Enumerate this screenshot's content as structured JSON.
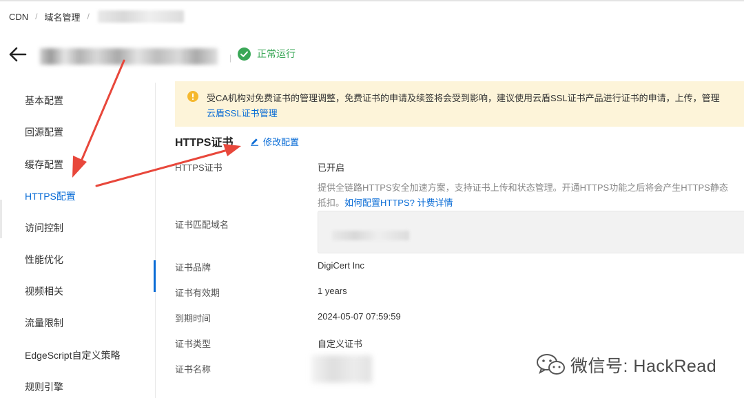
{
  "breadcrumb": {
    "items": [
      "CDN",
      "域名管理"
    ],
    "separator": "/"
  },
  "header": {
    "status": "正常运行"
  },
  "sidebar": {
    "items": [
      {
        "label": "基本配置"
      },
      {
        "label": "回源配置"
      },
      {
        "label": "缓存配置"
      },
      {
        "label": "HTTPS配置",
        "active": true
      },
      {
        "label": "访问控制"
      },
      {
        "label": "性能优化"
      },
      {
        "label": "视频相关"
      },
      {
        "label": "流量限制"
      },
      {
        "label": "EdgeScript自定义策略"
      },
      {
        "label": "规则引擎"
      }
    ]
  },
  "notice": {
    "text": "受CA机构对免费证书的管理调整，免费证书的申请及续签将会受到影响，建议使用云盾SSL证书产品进行证书的申请，上传，管理",
    "link": "云盾SSL证书管理"
  },
  "section": {
    "title": "HTTPS证书",
    "edit_label": "修改配置",
    "fields": {
      "https_cert_label": "HTTPS证书",
      "https_cert_value": "已开启",
      "desc_line1": "提供全链路HTTPS安全加速方案，支持证书上传和状态管理。开通HTTPS功能之后将会产生HTTPS静态",
      "desc_line2_prefix": "抵扣。",
      "desc_link1": "如何配置HTTPS?",
      "desc_link2": "计费详情",
      "domain_label": "证书匹配域名",
      "brand_label": "证书品牌",
      "brand_value": "DigiCert Inc",
      "validity_label": "证书有效期",
      "validity_value": "1 years",
      "expiry_label": "到期时间",
      "expiry_value": "2024-05-07 07:59:59",
      "type_label": "证书类型",
      "type_value": "自定义证书",
      "name_label": "证书名称"
    }
  },
  "watermark": {
    "text": "微信号: HackRead"
  },
  "colors": {
    "accent": "#0a6cd6",
    "success": "#3aa757",
    "warning": "#f5b82e",
    "notice_bg": "#fdf4d9",
    "arrow": "#e8473b"
  }
}
